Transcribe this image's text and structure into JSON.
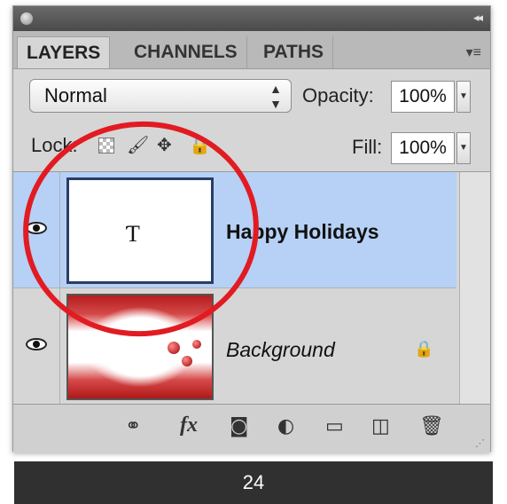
{
  "tabs": [
    {
      "label": "LAYERS",
      "active": true
    },
    {
      "label": "CHANNELS",
      "active": false
    },
    {
      "label": "PATHS",
      "active": false
    }
  ],
  "controls": {
    "blend_mode": "Normal",
    "opacity_label": "Opacity:",
    "opacity_value": "100%",
    "lock_label": "Lock:",
    "fill_label": "Fill:",
    "fill_value": "100%"
  },
  "layers": [
    {
      "name": "Happy Holidays",
      "thumbnail_glyph": "Ƭ",
      "selected": true,
      "visible": true,
      "style": "bold"
    },
    {
      "name": "Background",
      "selected": false,
      "visible": true,
      "locked": true,
      "style": "italic"
    }
  ],
  "footer_icons": [
    "link-layers-icon",
    "fx-icon",
    "layer-mask-icon",
    "adjustment-layer-icon",
    "new-group-icon",
    "new-layer-icon",
    "trash-icon"
  ],
  "footer_fx_label": "fx",
  "page_number": "24",
  "colors": {
    "selection": "#b6d1f5",
    "annotation_circle": "#e21b22",
    "bottom_bar": "#303030"
  }
}
